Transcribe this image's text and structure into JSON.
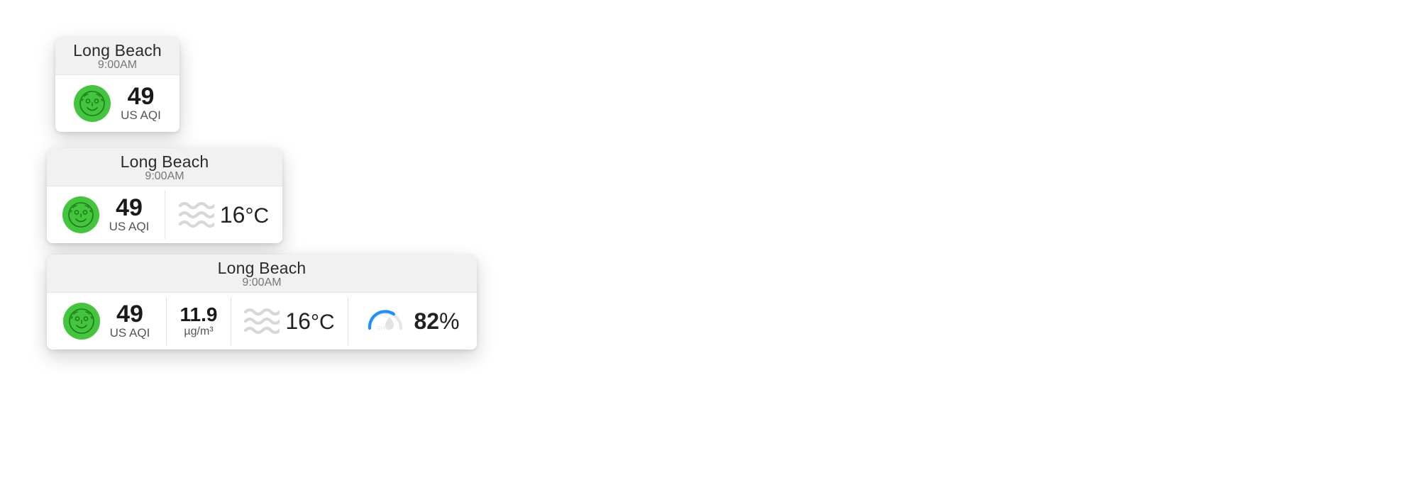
{
  "location": "Long Beach",
  "time": "9:00AM",
  "aqi": {
    "value": "49",
    "label": "US AQI"
  },
  "pm": {
    "value": "11.9",
    "unit": "µg/m³"
  },
  "temp": {
    "value": "16",
    "unit": "°C"
  },
  "humidity": {
    "value": "82",
    "unit": "%"
  },
  "humidity_icon_label": "RH%",
  "colors": {
    "aqi_good": "#43c53d",
    "gauge_blue": "#1f8fff"
  }
}
